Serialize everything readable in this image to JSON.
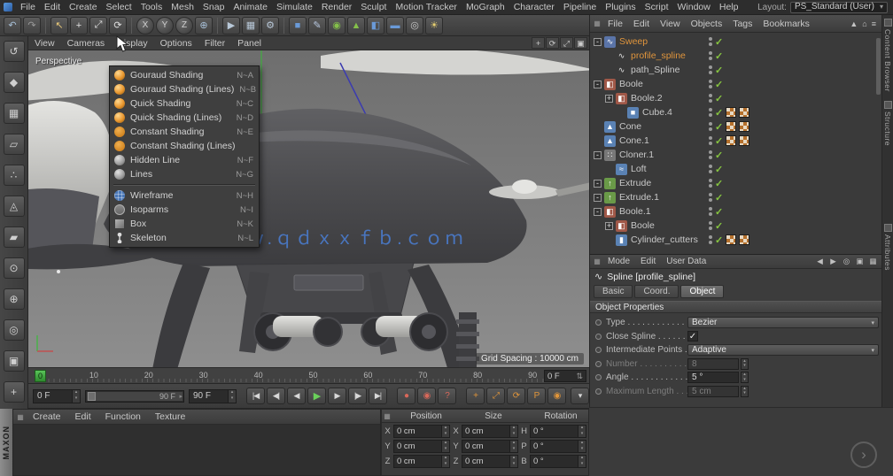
{
  "icons": {
    "caret_down": "▾",
    "spinner_up": "▴",
    "spinner_down": "▾",
    "updown": "⇅",
    "check": "✓",
    "grid_handle": "▦",
    "expand_minus": "-",
    "expand_plus": "+",
    "tri_left": "◂",
    "tri_right": "▸",
    "next_arrow": "›",
    "spline_glyph": "∿"
  },
  "menubar": {
    "items": [
      "File",
      "Edit",
      "Create",
      "Select",
      "Tools",
      "Mesh",
      "Snap",
      "Animate",
      "Simulate",
      "Render",
      "Sculpt",
      "Motion Tracker",
      "MoGraph",
      "Character",
      "Pipeline",
      "Plugins",
      "Script",
      "Window",
      "Help"
    ],
    "layout_label": "Layout:",
    "layout_value": "PS_Standard (User)"
  },
  "toolbar": {
    "icons": [
      {
        "name": "undo",
        "glyph": "↶",
        "color": "#a8c0d8"
      },
      {
        "name": "redo",
        "glyph": "↷",
        "color": "#9a9a9a"
      },
      {
        "name": "live-selection",
        "glyph": "↖",
        "color": "#e8c878",
        "sep": true
      },
      {
        "name": "move-tool",
        "glyph": "+",
        "color": "#e0e0e0"
      },
      {
        "name": "scale-tool",
        "glyph": "⤢",
        "color": "#e0e0e0"
      },
      {
        "name": "rotate-tool",
        "glyph": "⟳",
        "color": "#e0e0e0"
      },
      {
        "name": "lock-x-axis",
        "glyph": "X",
        "round": true,
        "sep": true
      },
      {
        "name": "lock-y-axis",
        "glyph": "Y",
        "round": true
      },
      {
        "name": "lock-z-axis",
        "glyph": "Z",
        "round": true
      },
      {
        "name": "coordinate-system",
        "glyph": "⊕",
        "color": "#a8c0d8"
      },
      {
        "name": "render-view",
        "glyph": "▶",
        "color": "#b8c8d8",
        "sep": true
      },
      {
        "name": "render-region",
        "glyph": "▦",
        "color": "#b8c8d8"
      },
      {
        "name": "render-settings",
        "glyph": "⚙",
        "color": "#b8c8d8"
      },
      {
        "name": "add-cube",
        "glyph": "■",
        "color": "#6a9ad8",
        "sep": true
      },
      {
        "name": "add-spline",
        "glyph": "✎",
        "color": "#b8c8e0"
      },
      {
        "name": "add-subdivision-surface",
        "glyph": "◉",
        "color": "#84c04a"
      },
      {
        "name": "add-generator",
        "glyph": "▲",
        "color": "#84c04a"
      },
      {
        "name": "add-modeling-object",
        "glyph": "◧",
        "color": "#6a9ad8"
      },
      {
        "name": "add-floor",
        "glyph": "▬",
        "color": "#6a9ad8"
      },
      {
        "name": "add-camera",
        "glyph": "◎",
        "color": "#c8c8c8"
      },
      {
        "name": "add-light",
        "glyph": "☀",
        "color": "#e8d070"
      }
    ]
  },
  "left_toolbar": {
    "icons": [
      {
        "name": "convert-object",
        "glyph": "↺"
      },
      {
        "name": "model-mode",
        "glyph": "◆"
      },
      {
        "name": "texture-mode",
        "glyph": "▦"
      },
      {
        "name": "workplane-mode",
        "glyph": "▱"
      },
      {
        "name": "points-mode",
        "glyph": "∴"
      },
      {
        "name": "edges-mode",
        "glyph": "◬"
      },
      {
        "name": "polygons-mode",
        "glyph": "▰"
      },
      {
        "name": "uv-mode",
        "glyph": "⊙"
      },
      {
        "name": "axis-mode",
        "glyph": "⊕"
      },
      {
        "name": "snap-mode",
        "glyph": "◎"
      },
      {
        "name": "workplane-lock",
        "glyph": "▣"
      },
      {
        "name": "viewport-solo",
        "glyph": "+"
      }
    ]
  },
  "viewport": {
    "menu_items": [
      "View",
      "Cameras",
      "Display",
      "Options",
      "Filter",
      "Panel"
    ],
    "nav_icons": [
      {
        "name": "pan-view",
        "glyph": "+"
      },
      {
        "name": "rotate-view",
        "glyph": "⟳"
      },
      {
        "name": "zoom-view",
        "glyph": "⤢"
      },
      {
        "name": "toggle-panels",
        "glyph": "▣"
      }
    ],
    "camera_label": "Perspective",
    "grid_spacing": "Grid Spacing : 10000 cm",
    "watermark": "视艺CG ｗｗｗ.ｑｄｘｘｆｂ.ｃｏｍ"
  },
  "display_menu": {
    "items": [
      {
        "label": "Gouraud Shading",
        "shortcut": "N~A",
        "icon": "sphere-shaded"
      },
      {
        "label": "Gouraud Shading (Lines)",
        "shortcut": "N~B",
        "icon": "sphere-shaded"
      },
      {
        "label": "Quick Shading",
        "shortcut": "N~C",
        "icon": "sphere-shaded"
      },
      {
        "label": "Quick Shading (Lines)",
        "shortcut": "N~D",
        "icon": "sphere-shaded"
      },
      {
        "label": "Constant Shading",
        "shortcut": "N~E",
        "icon": "sphere-flat"
      },
      {
        "label": "Constant Shading (Lines)",
        "shortcut": "",
        "icon": "sphere-flat"
      },
      {
        "label": "Hidden Line",
        "shortcut": "N~F",
        "icon": "sphere-wire"
      },
      {
        "label": "Lines",
        "shortcut": "N~G",
        "icon": "sphere-wire"
      },
      {
        "label": "Wireframe",
        "shortcut": "N~H",
        "icon": "wireframe",
        "separator_before": true
      },
      {
        "label": "Isoparms",
        "shortcut": "N~I",
        "icon": "isoparms"
      },
      {
        "label": "Box",
        "shortcut": "N~K",
        "icon": "box"
      },
      {
        "label": "Skeleton",
        "shortcut": "N~L",
        "icon": "skeleton"
      }
    ]
  },
  "timeline": {
    "marker_label": "0",
    "current_frame": "0 F",
    "ticks": [
      {
        "frame": 10,
        "label": "10"
      },
      {
        "frame": 20,
        "label": "20"
      },
      {
        "frame": 30,
        "label": "30"
      },
      {
        "frame": 40,
        "label": "40"
      },
      {
        "frame": 50,
        "label": "50"
      },
      {
        "frame": 60,
        "label": "60"
      },
      {
        "frame": 70,
        "label": "70"
      },
      {
        "frame": 80,
        "label": "80"
      },
      {
        "frame": 90,
        "label": "90"
      }
    ]
  },
  "playback": {
    "start_frame": "0 F",
    "slider_end": "90 F",
    "end_frame": "90 F",
    "transport": [
      {
        "name": "goto-start",
        "glyph": "|◀"
      },
      {
        "name": "prev-key",
        "glyph": "◀|"
      },
      {
        "name": "prev-frame",
        "glyph": "◀"
      },
      {
        "name": "play",
        "glyph": "▶",
        "accent": true
      },
      {
        "name": "next-frame",
        "glyph": "▶"
      },
      {
        "name": "next-key",
        "glyph": "|▶"
      },
      {
        "name": "goto-end",
        "glyph": "▶|"
      }
    ],
    "record_icons": [
      {
        "name": "record-keyframe",
        "glyph": "●"
      },
      {
        "name": "autokeying",
        "glyph": "◉"
      },
      {
        "name": "keyframe-help",
        "glyph": "?"
      }
    ],
    "channel_icons": [
      {
        "name": "key-position",
        "glyph": "+"
      },
      {
        "name": "key-scale",
        "glyph": "⤢"
      },
      {
        "name": "key-rotation",
        "glyph": "⟳"
      },
      {
        "name": "key-parameter",
        "glyph": "P"
      },
      {
        "name": "key-point-level",
        "glyph": "◉"
      }
    ],
    "options_icon": {
      "name": "playback-options",
      "glyph": "▾"
    }
  },
  "object_manager": {
    "menu": [
      "File",
      "Edit",
      "View",
      "Objects",
      "Tags",
      "Bookmarks"
    ],
    "menu_icons": [
      {
        "name": "up-arrow",
        "glyph": "▲"
      },
      {
        "name": "home",
        "glyph": "⌂"
      },
      {
        "name": "list",
        "glyph": "≡"
      }
    ],
    "icon_map": {
      "sweep": {
        "glyph": "∿",
        "bg": "#5a74a8"
      },
      "spline": {
        "glyph": "∿",
        "bg": "transparent",
        "fg": "#e4e4e4"
      },
      "boole": {
        "glyph": "◧",
        "bg": "#a05848"
      },
      "cube": {
        "glyph": "■",
        "bg": "#5a82b4"
      },
      "cone": {
        "glyph": "▲",
        "bg": "#5a82b4"
      },
      "cloner": {
        "glyph": "∷",
        "bg": "#787878"
      },
      "loft": {
        "glyph": "≈",
        "bg": "#5a82b4"
      },
      "extrude": {
        "glyph": "↑",
        "bg": "#6a9a48"
      },
      "cylinder": {
        "glyph": "▮",
        "bg": "#5a82b4"
      }
    },
    "objects": [
      {
        "label": "Sweep",
        "depth": 0,
        "expand": "minus",
        "icon": "sweep",
        "highlight": true,
        "tags": 0
      },
      {
        "label": "profile_spline",
        "depth": 1,
        "expand": "none",
        "icon": "spline",
        "highlight": true,
        "tags": 0
      },
      {
        "label": "path_Spline",
        "depth": 1,
        "expand": "none",
        "icon": "spline",
        "tags": 0
      },
      {
        "label": "Boole",
        "depth": 0,
        "expand": "minus",
        "icon": "boole",
        "tags": 0
      },
      {
        "label": "Boole.2",
        "depth": 1,
        "expand": "plus",
        "icon": "boole",
        "tags": 0
      },
      {
        "label": "Cube.4",
        "depth": 2,
        "expand": "none",
        "icon": "cube",
        "tags": 2
      },
      {
        "label": "Cone",
        "depth": 0,
        "expand": "none",
        "icon": "cone",
        "tags": 2
      },
      {
        "label": "Cone.1",
        "depth": 0,
        "expand": "none",
        "icon": "cone",
        "tags": 2
      },
      {
        "label": "Cloner.1",
        "depth": 0,
        "expand": "minus",
        "icon": "cloner",
        "tags": 0
      },
      {
        "label": "Loft",
        "depth": 1,
        "expand": "none",
        "icon": "loft",
        "tags": 0
      },
      {
        "label": "Extrude",
        "depth": 0,
        "expand": "minus",
        "icon": "extrude",
        "tags": 0
      },
      {
        "label": "Extrude.1",
        "depth": 0,
        "expand": "minus",
        "icon": "extrude",
        "tags": 0
      },
      {
        "label": "Boole.1",
        "depth": 0,
        "expand": "minus",
        "icon": "boole",
        "tags": 0
      },
      {
        "label": "Boole",
        "depth": 1,
        "expand": "plus",
        "icon": "boole",
        "tags": 0
      },
      {
        "label": "Cylinder_cutters",
        "depth": 1,
        "expand": "none",
        "icon": "cylinder",
        "tags": 2
      }
    ]
  },
  "attributes": {
    "menu": [
      "Mode",
      "Edit",
      "User Data"
    ],
    "menu_icons": [
      {
        "name": "nav-back",
        "glyph": "◀"
      },
      {
        "name": "nav-forward",
        "glyph": "▶"
      },
      {
        "name": "search",
        "glyph": "◎"
      },
      {
        "name": "lock",
        "glyph": "▣"
      },
      {
        "name": "panel-layout",
        "glyph": "▦"
      }
    ],
    "title": "Spline [profile_spline]",
    "tabs": [
      "Basic",
      "Coord.",
      "Object"
    ],
    "active_tab": "Object",
    "section": "Object Properties",
    "rows": [
      {
        "label": "Type . . . . . . . . . . . .",
        "control": "dropdown",
        "value": "Bezier",
        "enabled": true
      },
      {
        "label": "Close Spline . . . . . . .",
        "control": "checkbox",
        "value": "✓",
        "enabled": true
      },
      {
        "label": "Intermediate Points .",
        "control": "dropdown",
        "value": "Adaptive",
        "enabled": true
      },
      {
        "label": "Number . . . . . . . . . .",
        "control": "spinner",
        "value": "8",
        "enabled": false
      },
      {
        "label": "Angle . . . . . . . . . . . .",
        "control": "spinner",
        "value": "5 °",
        "enabled": true
      },
      {
        "label": "Maximum Length . . .",
        "control": "spinner",
        "value": "5 cm",
        "enabled": false
      }
    ]
  },
  "material_manager": {
    "menu": [
      "Create",
      "Edit",
      "Function",
      "Texture"
    ]
  },
  "coordinates": {
    "groups": [
      {
        "header": "Position",
        "rows": [
          {
            "axis": "X",
            "value": "0 cm"
          },
          {
            "axis": "Y",
            "value": "0 cm"
          },
          {
            "axis": "Z",
            "value": "0 cm"
          }
        ]
      },
      {
        "header": "Size",
        "rows": [
          {
            "axis": "X",
            "value": "0 cm"
          },
          {
            "axis": "Y",
            "value": "0 cm"
          },
          {
            "axis": "Z",
            "value": "0 cm"
          }
        ]
      },
      {
        "header": "Rotation",
        "rows": [
          {
            "axis": "H",
            "value": "0 °"
          },
          {
            "axis": "P",
            "value": "0 °"
          },
          {
            "axis": "B",
            "value": "0 °"
          }
        ]
      }
    ]
  },
  "right_dock": {
    "upper_tabs": [
      "Content Browser",
      "Structure"
    ],
    "lower_tab": "Attributes"
  },
  "branding": {
    "vertical": "MAXON"
  }
}
